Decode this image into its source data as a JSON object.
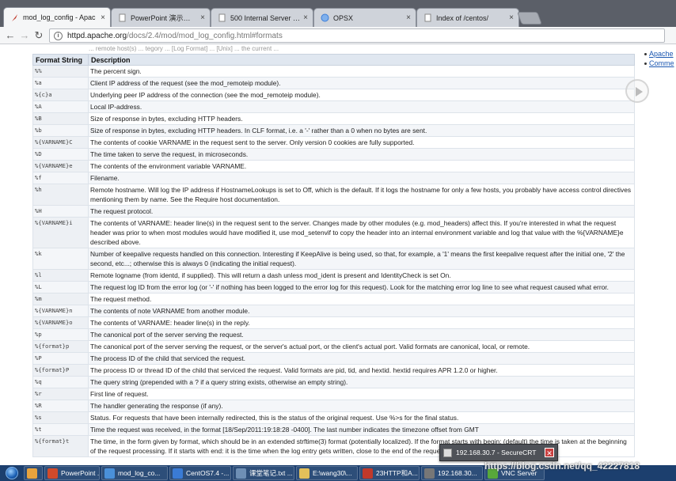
{
  "tabs": [
    {
      "title": "mod_log_config - Apac",
      "icon": "apache-feather-icon",
      "icon_color": "#c0392b",
      "active": true
    },
    {
      "title": "PowerPoint 演示文稿",
      "icon": "document-icon",
      "icon_color": "#999999",
      "active": false
    },
    {
      "title": "500 Internal Server Err",
      "icon": "document-icon",
      "icon_color": "#999999",
      "active": false
    },
    {
      "title": "OPSX",
      "icon": "globe-icon",
      "icon_color": "#3b7dd8",
      "active": false
    },
    {
      "title": "Index of /centos/",
      "icon": "document-icon",
      "icon_color": "#999999",
      "active": false
    }
  ],
  "address_bar": {
    "host": "httpd.apache.org",
    "path": "/docs/2.4/mod/mod_log_config.html#formats"
  },
  "sidebar_links": [
    "Apache",
    "Comme"
  ],
  "top_strip": "... remote host(s) ... tegory ... [Log Format] ... [Unix] ... the current ...",
  "table": {
    "headers": [
      "Format String",
      "Description"
    ],
    "rows": [
      [
        "%%",
        "The percent sign."
      ],
      [
        "%a",
        "Client IP address of the request (see the mod_remoteip module)."
      ],
      [
        "%{c}a",
        "Underlying peer IP address of the connection (see the mod_remoteip module)."
      ],
      [
        "%A",
        "Local IP-address."
      ],
      [
        "%B",
        "Size of response in bytes, excluding HTTP headers."
      ],
      [
        "%b",
        "Size of response in bytes, excluding HTTP headers. In CLF format, i.e. a '-' rather than a 0 when no bytes are sent."
      ],
      [
        "%{VARNAME}C",
        "The contents of cookie VARNAME in the request sent to the server. Only version 0 cookies are fully supported."
      ],
      [
        "%D",
        "The time taken to serve the request, in microseconds."
      ],
      [
        "%{VARNAME}e",
        "The contents of the environment variable VARNAME."
      ],
      [
        "%f",
        "Filename."
      ],
      [
        "%h",
        "Remote hostname. Will log the IP address if HostnameLookups is set to Off, which is the default. If it logs the hostname for only a few hosts, you probably have access control directives mentioning them by name. See the Require host documentation."
      ],
      [
        "%H",
        "The request protocol."
      ],
      [
        "%{VARNAME}i",
        "The contents of VARNAME: header line(s) in the request sent to the server. Changes made by other modules (e.g. mod_headers) affect this. If you're interested in what the request header was prior to when most modules would have modified it, use mod_setenvif to copy the header into an internal environment variable and log that value with the %{VARNAME}e described above."
      ],
      [
        "%k",
        "Number of keepalive requests handled on this connection. Interesting if KeepAlive is being used, so that, for example, a '1' means the first keepalive request after the initial one, '2' the second, etc...; otherwise this is always 0 (indicating the initial request)."
      ],
      [
        "%l",
        "Remote logname (from identd, if supplied). This will return a dash unless mod_ident is present and IdentityCheck is set On."
      ],
      [
        "%L",
        "The request log ID from the error log (or '-' if nothing has been logged to the error log for this request). Look for the matching error log line to see what request caused what error."
      ],
      [
        "%m",
        "The request method."
      ],
      [
        "%{VARNAME}n",
        "The contents of note VARNAME from another module."
      ],
      [
        "%{VARNAME}o",
        "The contents of VARNAME: header line(s) in the reply."
      ],
      [
        "%p",
        "The canonical port of the server serving the request."
      ],
      [
        "%{format}p",
        "The canonical port of the server serving the request, or the server's actual port, or the client's actual port. Valid formats are canonical, local, or remote."
      ],
      [
        "%P",
        "The process ID of the child that serviced the request."
      ],
      [
        "%{format}P",
        "The process ID or thread ID of the child that serviced the request. Valid formats are pid, tid, and hextid. hextid requires APR 1.2.0 or higher."
      ],
      [
        "%q",
        "The query string (prepended with a ? if a query string exists, otherwise an empty string)."
      ],
      [
        "%r",
        "First line of request."
      ],
      [
        "%R",
        "The handler generating the response (if any)."
      ],
      [
        "%s",
        "Status. For requests that have been internally redirected, this is the status of the original request. Use %>s for the final status."
      ],
      [
        "%t",
        "Time the request was received, in the format [18/Sep/2011:19:18:28 -0400]. The last number indicates the timezone offset from GMT"
      ],
      [
        "%{format}t",
        "The time, in the form given by format, which should be in an extended strftime(3) format (potentially localized). If the format starts with begin: (default) the time is taken at the beginning of the request processing. If it starts with end: it is the time when the log entry gets written, close to the end of the request processing. In"
      ]
    ]
  },
  "popup": {
    "title": "192.168.30.7 - SecureCRT",
    "close": "✕"
  },
  "watermark": "https://blog.csdn.net/qq_42227818",
  "taskbar": [
    {
      "label": "",
      "icon_color": "#e8a33d"
    },
    {
      "label": "PowerPoint ...",
      "icon_color": "#d04a2a"
    },
    {
      "label": "mod_log_co...",
      "icon_color": "#4a90d9"
    },
    {
      "label": "CentOS7.4 -...",
      "icon_color": "#3a7bd5"
    },
    {
      "label": "课堂笔记.txt ...",
      "icon_color": "#6e8fb5"
    },
    {
      "label": "E:\\wang30\\...",
      "icon_color": "#e3c05a"
    },
    {
      "label": "23HTTP和A...",
      "icon_color": "#c0392b"
    },
    {
      "label": "192.168.30...",
      "icon_color": "#777777"
    },
    {
      "label": "VNC Server",
      "icon_color": "#58a83b"
    }
  ]
}
